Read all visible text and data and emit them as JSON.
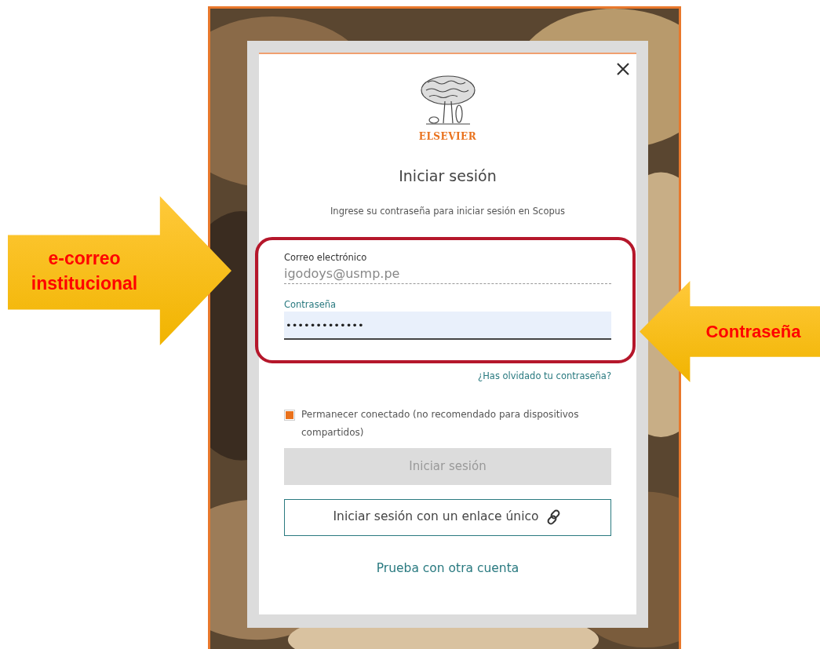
{
  "callouts": [
    {
      "kind": "arrow-right",
      "text": "e-correo institucional"
    },
    {
      "kind": "arrow-left",
      "text": "Contraseña"
    }
  ],
  "dialog": {
    "logo_text": "ELSEVIER",
    "title": "Iniciar sesión",
    "subtitle": "Ingrese su contraseña para iniciar sesión en Scopus",
    "fields": [
      {
        "label": "Correo electrónico",
        "value": "igodoys@usmp.pe",
        "focused": false
      },
      {
        "label": "Contraseña",
        "value": "•••••••••••••",
        "focused": true
      }
    ],
    "forgot_link": "¿Has olvidado tu contraseña?",
    "remember": {
      "label": "Permanecer conectado (no recomendado para dispositivos compartidos)",
      "checked": true
    },
    "buttons": [
      {
        "kind": "primary",
        "label": "Iniciar sesión",
        "disabled": true
      },
      {
        "kind": "outline-link",
        "label": "Iniciar sesión con un enlace único",
        "disabled": false
      }
    ],
    "other_account_link": "Prueba con otra cuenta"
  }
}
